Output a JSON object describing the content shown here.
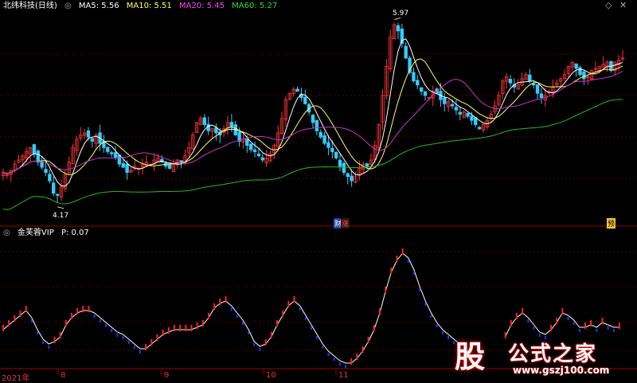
{
  "header": {
    "title": "北纬科技(日线)",
    "ma": [
      {
        "label": "MA5: 5.56",
        "color": "#ffffff"
      },
      {
        "label": "MA10: 5.51",
        "color": "#ffff66"
      },
      {
        "label": "MA20: 5.45",
        "color": "#ff44ff"
      },
      {
        "label": "MA60: 5.27",
        "color": "#33dd33"
      }
    ]
  },
  "indicator": {
    "title": "金芙蓉VIP",
    "value_label": "P: 0.07"
  },
  "markers": {
    "high": "5.97",
    "low": "4.17",
    "event1": "财",
    "event2": "涨",
    "event3": "预"
  },
  "x_labels": [
    "2021年",
    "8",
    "9",
    "10",
    "11"
  ],
  "watermark": {
    "glyph": "股",
    "name": "公式之家",
    "url": "www.gszj100.com"
  },
  "colors": {
    "up": "#ff3333",
    "down": "#33ccff",
    "ma5": "#ffffff",
    "ma10": "#ffff66",
    "ma20": "#cc33cc",
    "ma60": "#22bb22",
    "osc_up": "#ff2222",
    "osc_down": "#2233ff"
  },
  "chart_data": [
    {
      "type": "candlestick",
      "title": "北纬科技(日线)",
      "ylim": [
        4.0,
        6.05
      ],
      "marked_high": 5.97,
      "marked_low": 4.17,
      "x_ticks": [
        "2021年",
        "8",
        "9",
        "10",
        "11"
      ],
      "close": [
        4.5,
        4.48,
        4.52,
        4.58,
        4.62,
        4.66,
        4.7,
        4.74,
        4.68,
        4.6,
        4.55,
        4.5,
        4.42,
        4.3,
        4.28,
        4.36,
        4.48,
        4.6,
        4.74,
        4.82,
        4.86,
        4.88,
        4.84,
        4.8,
        4.86,
        4.78,
        4.74,
        4.7,
        4.68,
        4.64,
        4.58,
        4.55,
        4.5,
        4.52,
        4.56,
        4.54,
        4.58,
        4.6,
        4.58,
        4.62,
        4.64,
        4.6,
        4.56,
        4.54,
        4.58,
        4.62,
        4.6,
        4.66,
        4.74,
        4.86,
        4.98,
        5.02,
        4.96,
        4.9,
        4.92,
        4.88,
        4.86,
        4.92,
        4.98,
        4.94,
        4.86,
        4.8,
        4.82,
        4.76,
        4.72,
        4.7,
        4.66,
        4.62,
        4.64,
        4.68,
        4.76,
        4.88,
        5.02,
        5.2,
        5.26,
        5.3,
        5.28,
        5.22,
        5.16,
        5.08,
        4.98,
        4.9,
        4.84,
        4.78,
        4.74,
        4.7,
        4.64,
        4.56,
        4.5,
        4.46,
        4.42,
        4.46,
        4.54,
        4.58,
        4.56,
        4.62,
        4.76,
        4.96,
        5.24,
        5.52,
        5.8,
        5.92,
        5.86,
        5.74,
        5.6,
        5.46,
        5.38,
        5.34,
        5.28,
        5.24,
        5.22,
        5.28,
        5.26,
        5.2,
        5.16,
        5.18,
        5.14,
        5.1,
        5.06,
        5.08,
        5.04,
        5.0,
        4.96,
        4.92,
        4.96,
        5.0,
        5.06,
        5.14,
        5.24,
        5.38,
        5.42,
        5.36,
        5.32,
        5.34,
        5.4,
        5.44,
        5.38,
        5.34,
        5.26,
        5.22,
        5.24,
        5.28,
        5.32,
        5.36,
        5.4,
        5.44,
        5.52,
        5.56,
        5.5,
        5.44,
        5.4,
        5.42,
        5.48,
        5.5,
        5.52,
        5.54,
        5.56,
        5.48,
        5.56,
        5.58,
        5.6
      ],
      "series": [
        {
          "name": "MA5",
          "last": 5.56
        },
        {
          "name": "MA10",
          "last": 5.51
        },
        {
          "name": "MA20",
          "last": 5.45
        },
        {
          "name": "MA60",
          "last": 5.27
        }
      ]
    },
    {
      "type": "line",
      "title": "金芙蓉VIP",
      "last": 0.07,
      "ylim": [
        -0.08,
        0.46
      ],
      "values": [
        0.08,
        0.1,
        0.12,
        0.14,
        0.16,
        0.13,
        0.08,
        0.04,
        0.02,
        0.03,
        0.05,
        0.1,
        0.13,
        0.15,
        0.16,
        0.16,
        0.15,
        0.13,
        0.11,
        0.09,
        0.07,
        0.06,
        0.04,
        0.02,
        0.0,
        0.0,
        0.02,
        0.04,
        0.06,
        0.07,
        0.08,
        0.08,
        0.08,
        0.08,
        0.09,
        0.1,
        0.13,
        0.17,
        0.19,
        0.2,
        0.18,
        0.15,
        0.12,
        0.08,
        0.03,
        0.01,
        0.02,
        0.05,
        0.1,
        0.14,
        0.18,
        0.2,
        0.18,
        0.14,
        0.1,
        0.06,
        0.02,
        -0.01,
        -0.03,
        -0.05,
        -0.06,
        -0.06,
        -0.04,
        -0.01,
        0.03,
        0.08,
        0.15,
        0.24,
        0.32,
        0.37,
        0.4,
        0.38,
        0.33,
        0.26,
        0.2,
        0.15,
        0.11,
        0.08,
        0.06,
        0.04,
        0.02,
        null,
        null,
        null,
        null,
        null,
        null,
        null,
        0.05,
        0.1,
        0.13,
        0.15,
        0.13,
        0.1,
        0.07,
        0.06,
        0.08,
        0.11,
        0.15,
        0.14,
        0.12,
        0.09,
        0.09,
        0.1,
        0.09,
        0.11,
        0.1,
        0.09,
        0.09
      ]
    }
  ]
}
